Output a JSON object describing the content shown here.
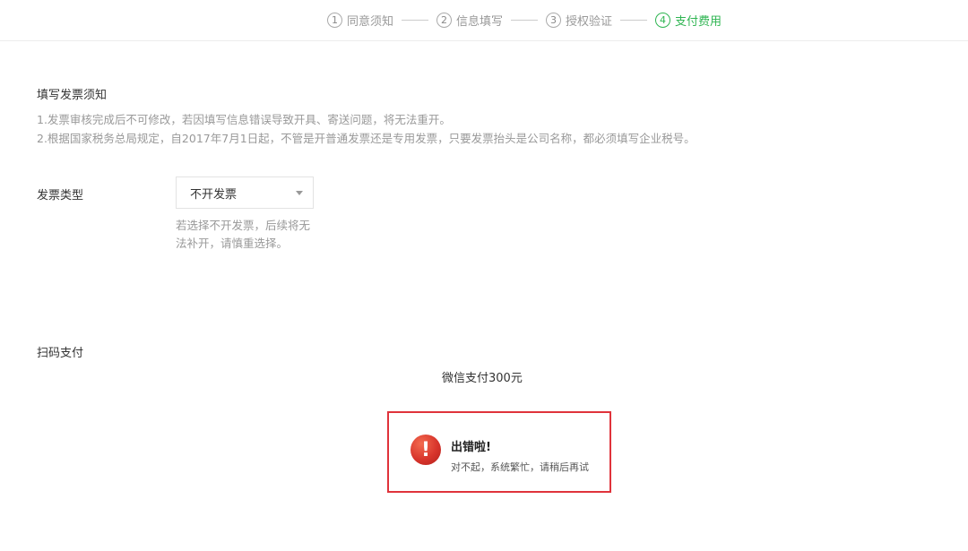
{
  "stepper": {
    "steps": [
      {
        "num": "1",
        "label": "同意须知"
      },
      {
        "num": "2",
        "label": "信息填写"
      },
      {
        "num": "3",
        "label": "授权验证"
      },
      {
        "num": "4",
        "label": "支付费用"
      }
    ],
    "active_step": 4,
    "colors": {
      "active": "#2fb552",
      "inactive": "#999999"
    }
  },
  "notice": {
    "title": "填写发票须知",
    "lines": [
      "1.发票审核完成后不可修改，若因填写信息错误导致开具、寄送问题，将无法重开。",
      "2.根据国家税务总局规定，自2017年7月1日起，不管是开普通发票还是专用发票，只要发票抬头是公司名称，都必须填写企业税号。"
    ]
  },
  "invoice": {
    "label": "发票类型",
    "selected": "不开发票",
    "hint": "若选择不开发票，后续将无法补开，请慎重选择。"
  },
  "payment": {
    "label": "扫码支付",
    "amount_text": "微信支付300元"
  },
  "error": {
    "icon": "exclamation-icon",
    "title": "出错啦!",
    "message": "对不起，系统繁忙，请稍后再试",
    "border_color": "#e0333b"
  }
}
